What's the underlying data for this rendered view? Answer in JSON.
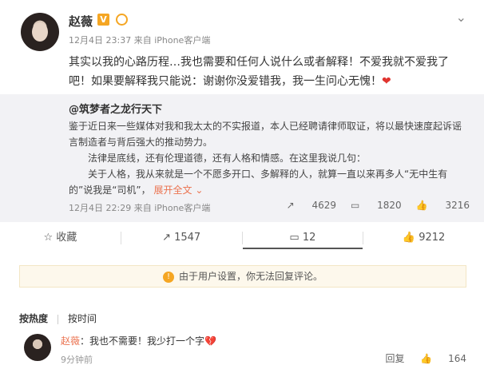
{
  "post": {
    "author": "赵薇",
    "time": "12月4日 23:37",
    "source": "来自 iPhone客户端",
    "text": "其实以我的心路历程…我也需要和任何人说什么或者解释！不爱我就不爱我了吧！如果要解释我只能说：谢谢你没爱错我，我一生问心无愧！"
  },
  "repost": {
    "author": "@筑梦者之龙行天下",
    "lines": [
      "鉴于近日来一些媒体对我和我太太的不实报道，本人已经聘请律师取证，将以最快速度起诉谣言制造者与背后强大的推动势力。",
      "法律是底线，还有伦理道德，还有人格和情感。在这里我说几句：",
      "关于人格，我从来就是一个不愿多开口、多解释的人，就算一直以来再多人“无中生有的”说我是“司机”，"
    ],
    "expand": "展开全文",
    "time": "12月4日 22:29",
    "source": "来自 iPhone客户端",
    "stats": {
      "repost": "4629",
      "comment": "1820",
      "like": "3216"
    }
  },
  "actions": {
    "collect": "收藏",
    "repost": "1547",
    "comment": "12",
    "like": "9212"
  },
  "notice": "由于用户设置，你无法回复评论。",
  "sort": {
    "hot": "按热度",
    "time": "按时间"
  },
  "comment": {
    "author": "赵薇",
    "sep": "：",
    "text": "我也不需要！我少打一个字",
    "time": "9分钟前",
    "reply": "回复",
    "likes": "164"
  }
}
